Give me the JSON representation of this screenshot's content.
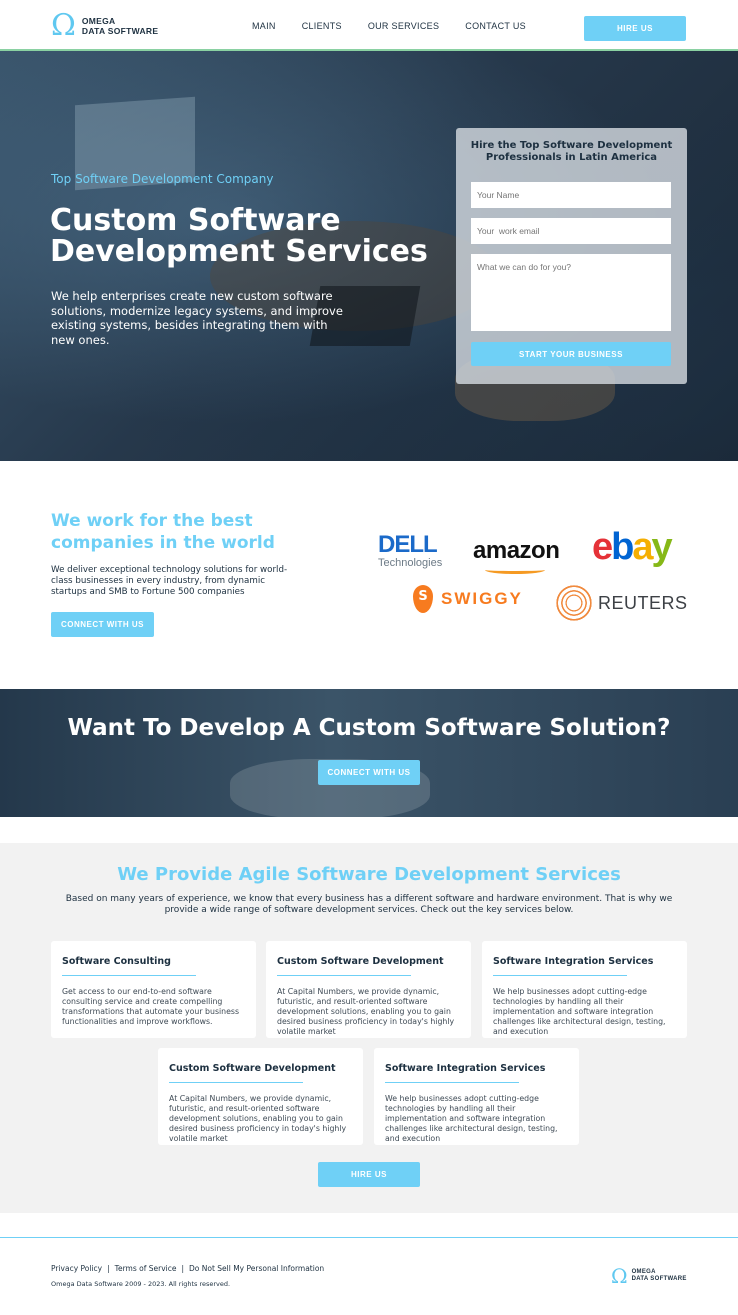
{
  "brand": {
    "line1": "OMEGA",
    "line2": "DATA SOFTWARE",
    "symbol": "Ω",
    "accent": "#6fd0f6"
  },
  "nav": {
    "items": [
      {
        "label": "MAIN"
      },
      {
        "label": "CLIENTS"
      },
      {
        "label": "OUR SERVICES"
      },
      {
        "label": "CONTACT US"
      }
    ],
    "hire_label": "HIRE US"
  },
  "hero": {
    "eyebrow": "Top Software Development Company",
    "title": "Custom Software Development Services",
    "description": "We help enterprises create new custom software solutions, modernize legacy systems, and improve existing systems, besides integrating them with new ones."
  },
  "form": {
    "title": "Hire the Top Software Development Professionals in Latin America",
    "name_placeholder": "Your Name",
    "email_placeholder": "Your  work email",
    "message_placeholder": "What we can do for you?",
    "submit_label": "START YOUR BUSINESS"
  },
  "partners": {
    "title": "We work for the best companies in the world",
    "description": "We deliver exceptional technology solutions for world-class businesses in every industry, from dynamic startups and SMB to Fortune 500 companies",
    "button_label": "CONNECT WITH US",
    "logos": {
      "dell": {
        "name": "DELL",
        "sub": "Technologies"
      },
      "amazon": "amazon",
      "ebay": {
        "e": "e",
        "b": "b",
        "a": "a",
        "y": "y"
      },
      "swiggy": {
        "mark": "S",
        "name": "SWIGGY"
      },
      "reuters": "REUTERS"
    }
  },
  "cta": {
    "title": "Want To Develop A Custom Software Solution?",
    "button_label": "CONNECT WITH US"
  },
  "services": {
    "title": "We Provide Agile Software Development Services",
    "description": "Based on many years of experience, we know that every business has a different software and hardware environment. That is why we provide a wide range of software development services. Check out the key services below.",
    "cards": [
      {
        "title": "Software Consulting",
        "text": "Get access to our end-to-end software consulting service and create compelling transformations that automate your business functionalities and improve workflows."
      },
      {
        "title": "Custom Software Development",
        "text": "At Capital Numbers, we provide dynamic, futuristic, and result-oriented software development solutions, enabling you to gain desired business proficiency in today's highly volatile market"
      },
      {
        "title": "Software Integration Services",
        "text": "We help businesses adopt cutting-edge technologies by handling all their implementation and software integration challenges like architectural design, testing, and execution"
      },
      {
        "title": "Custom Software Development",
        "text": "At Capital Numbers, we provide dynamic, futuristic, and result-oriented software development solutions, enabling you to gain desired business proficiency in today's highly volatile market"
      },
      {
        "title": "Software Integration Services",
        "text": "We help businesses adopt cutting-edge technologies by handling all their implementation and software integration challenges like architectural design, testing, and execution"
      }
    ],
    "button_label": "HIRE US"
  },
  "footer": {
    "links": [
      {
        "label": "Privacy Policy"
      },
      {
        "label": "Terms of Service"
      },
      {
        "label": "Do Not Sell My Personal Information"
      }
    ],
    "separator": "|",
    "copyright": "Omega Data Software 2009 - 2023. All rights reserved."
  }
}
